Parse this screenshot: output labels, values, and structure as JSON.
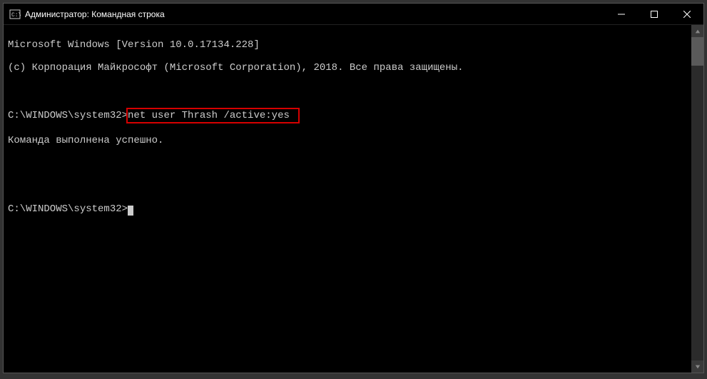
{
  "window": {
    "title": "Администратор: Командная строка"
  },
  "terminal": {
    "line1": "Microsoft Windows [Version 10.0.17134.228]",
    "line2": "(c) Корпорация Майкрософт (Microsoft Corporation), 2018. Все права защищены.",
    "prompt1_path": "C:\\WINDOWS\\system32>",
    "command1": "net user Thrash /active:yes",
    "result1": "Команда выполнена успешно.",
    "prompt2_path": "C:\\WINDOWS\\system32>"
  }
}
